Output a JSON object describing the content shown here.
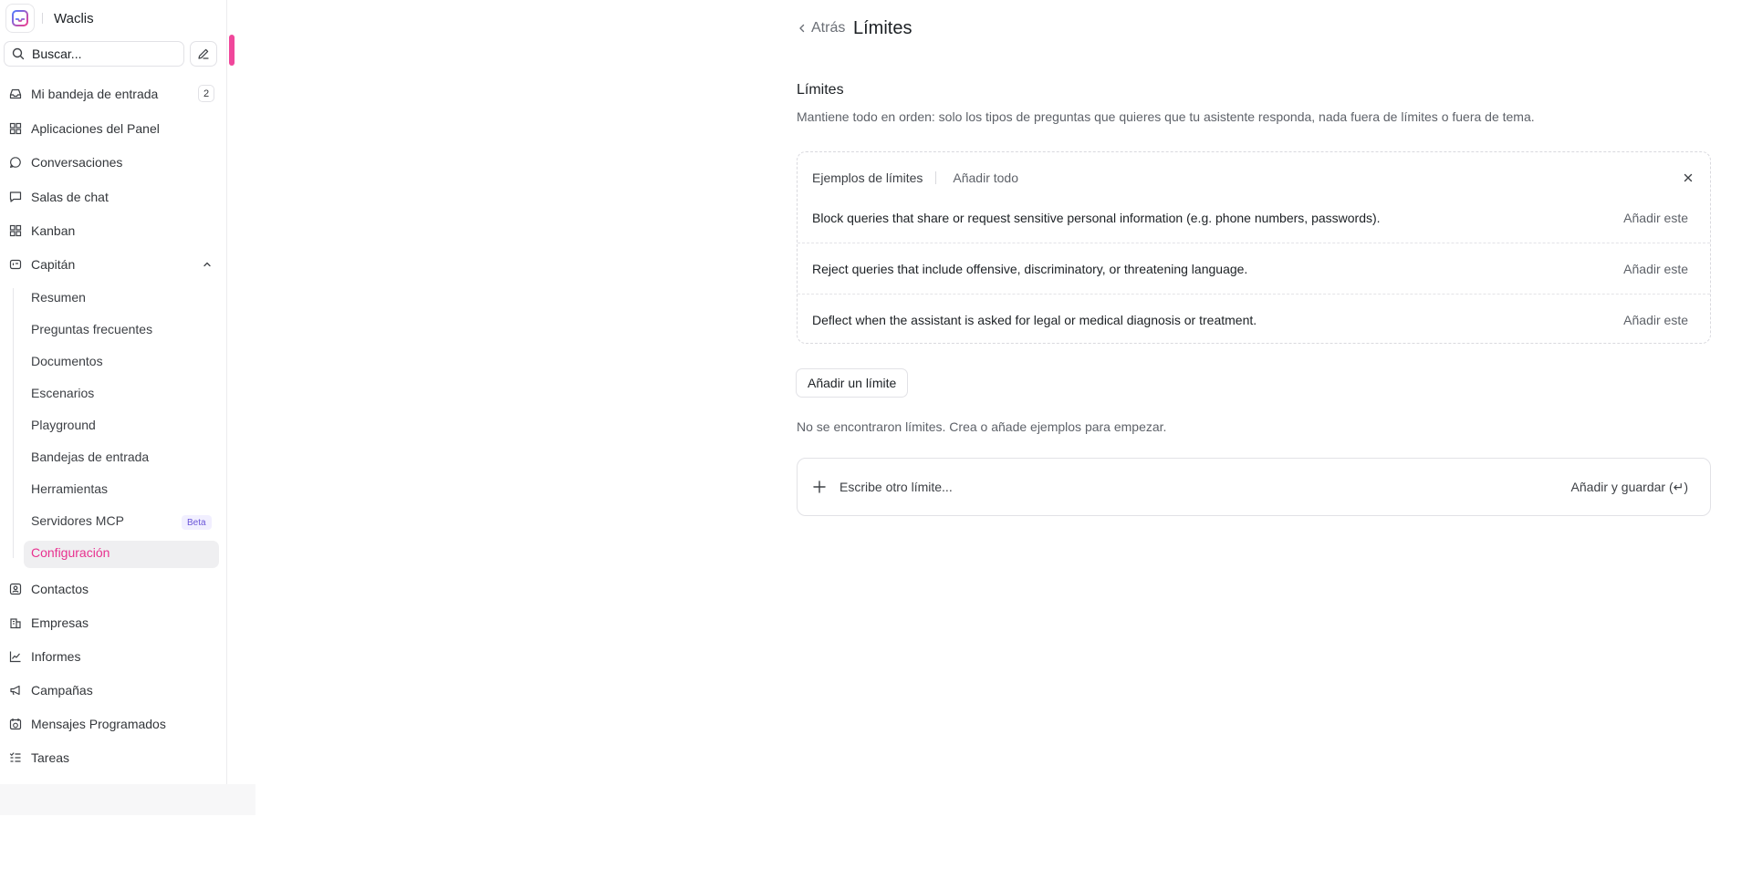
{
  "brand": {
    "name": "Waclis",
    "accent": "#e8318f"
  },
  "search": {
    "label": "Buscar..."
  },
  "nav": {
    "inbox": "Mi bandeja de entrada",
    "inbox_count": "2",
    "dashboard_apps": "Aplicaciones del Panel",
    "conversations": "Conversaciones",
    "chat_rooms": "Salas de chat",
    "kanban": "Kanban",
    "captain": "Capitán",
    "captain_sub": [
      "Resumen",
      "Preguntas frecuentes",
      "Documentos",
      "Escenarios",
      "Playground",
      "Bandejas de entrada",
      "Herramientas",
      "Servidores MCP",
      "Configuración"
    ],
    "beta_badge": "Beta",
    "contacts": "Contactos",
    "companies": "Empresas",
    "reports": "Informes",
    "campaigns": "Campañas",
    "scheduled": "Mensajes Programados",
    "tasks": "Tareas"
  },
  "header": {
    "back": "Atrás",
    "title": "Límites"
  },
  "section": {
    "title": "Límites",
    "description": "Mantiene todo en orden: solo los tipos de preguntas que quieres que tu asistente responda, nada fuera de límites o fuera de tema."
  },
  "examples": {
    "title": "Ejemplos de límites",
    "add_all": "Añadir todo",
    "add_one": "Añadir este",
    "items": [
      "Block queries that share or request sensitive personal information (e.g. phone numbers, passwords).",
      "Reject queries that include offensive, discriminatory, or threatening language.",
      "Deflect when the assistant is asked for legal or medical diagnosis or treatment."
    ]
  },
  "add_limit_button": "Añadir un límite",
  "empty_state": "No se encontraron límites. Crea o añade ejemplos para empezar.",
  "new_limit": {
    "placeholder": "Escribe otro límite...",
    "save_label": "Añadir y guardar (↵)"
  }
}
